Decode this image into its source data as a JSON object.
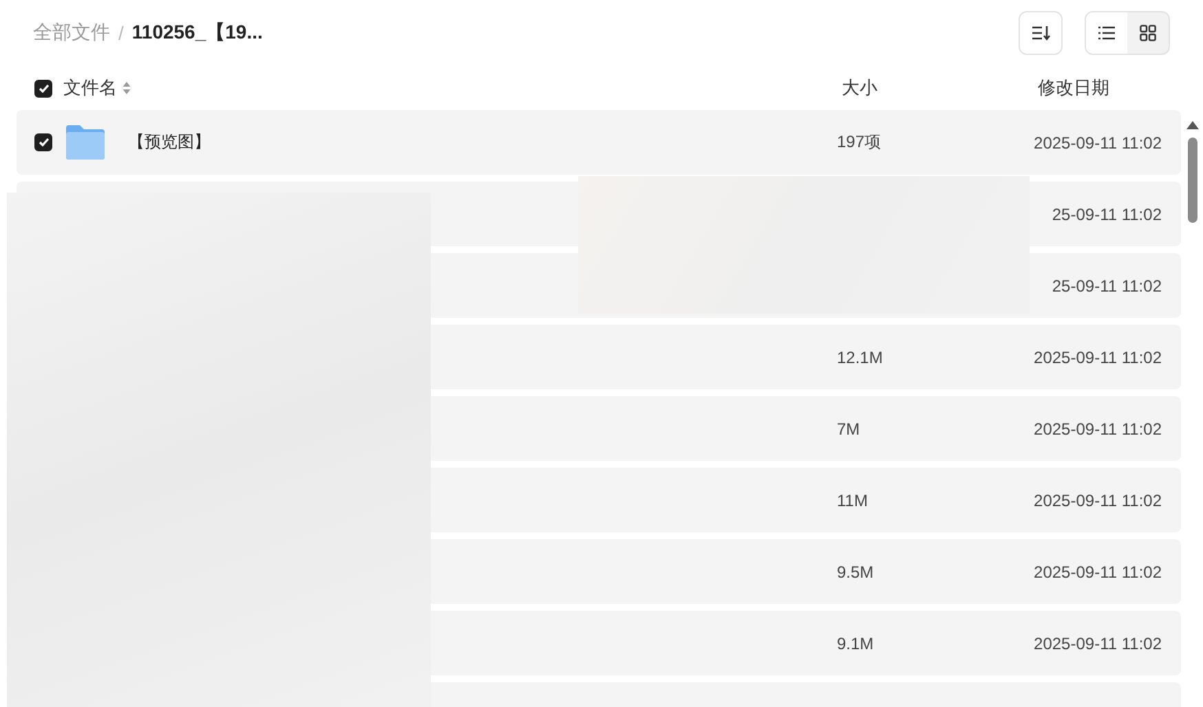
{
  "breadcrumb": {
    "separator": "/",
    "items": [
      {
        "label": "全部文件",
        "current": false
      },
      {
        "label": "110256_【19...",
        "current": true
      }
    ]
  },
  "toolbar": {
    "view_modes": [
      {
        "kind": "list",
        "selected": true
      },
      {
        "kind": "grid",
        "selected": false
      }
    ]
  },
  "table": {
    "select_all_checked": true,
    "columns": [
      {
        "label": "文件名",
        "sortable": true
      },
      {
        "label": "大小"
      },
      {
        "label": "修改日期"
      }
    ],
    "rows": [
      {
        "kind": "folder",
        "checked": true,
        "name": "【预览图】",
        "size": "197项",
        "date": "2025-09-11 11:02"
      },
      {
        "kind": "covered",
        "date": "25-09-11 11:02"
      },
      {
        "kind": "covered",
        "date": "25-09-11 11:02"
      },
      {
        "kind": "covered",
        "size": "12.1M",
        "date": "2025-09-11 11:02"
      },
      {
        "kind": "covered",
        "size": "7M",
        "date": "2025-09-11 11:02"
      },
      {
        "kind": "covered",
        "size": "11M",
        "date": "2025-09-11 11:02"
      },
      {
        "kind": "covered",
        "size": "9.5M",
        "date": "2025-09-11 11:02"
      },
      {
        "kind": "covered",
        "size": "9.1M",
        "date": "2025-09-11 11:02"
      }
    ]
  }
}
